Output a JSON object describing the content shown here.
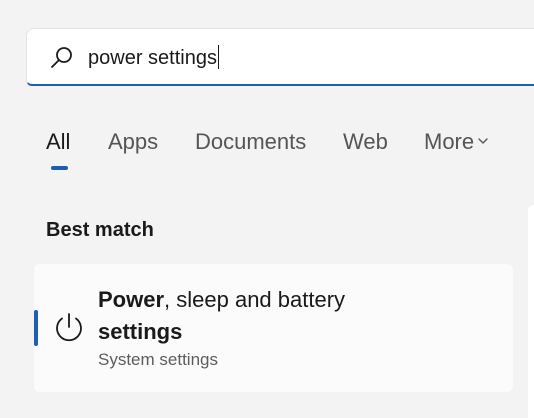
{
  "search": {
    "query": "power settings"
  },
  "tabs": [
    {
      "label": "All",
      "active": true
    },
    {
      "label": "Apps"
    },
    {
      "label": "Documents"
    },
    {
      "label": "Web"
    },
    {
      "label": "More"
    }
  ],
  "best_match": {
    "heading": "Best match",
    "result": {
      "title_part1": "Power",
      "title_part2": ", sleep and battery",
      "title_part3": "settings",
      "subtitle": "System settings",
      "icon": "power-icon"
    }
  },
  "colors": {
    "accent": "#1c5fae",
    "background": "#f3f3f3",
    "card": "#fbfbfb"
  }
}
